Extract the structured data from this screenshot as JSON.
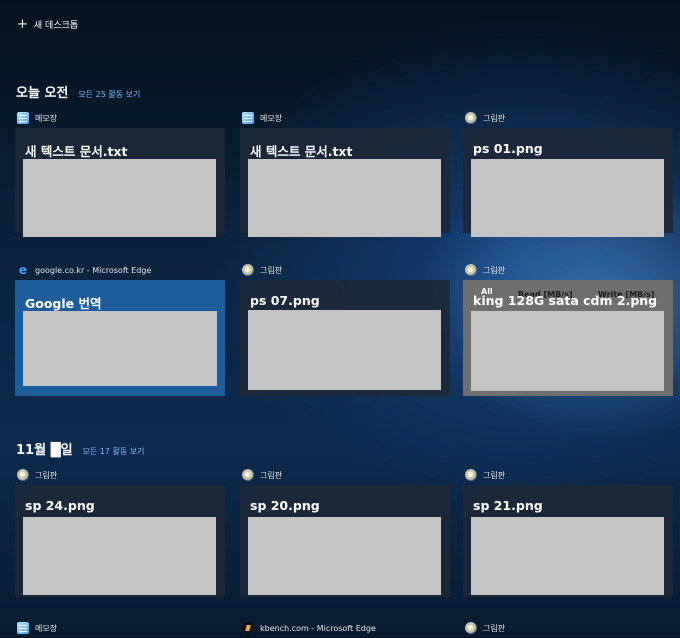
{
  "new_desktop": {
    "label": "새 데스크톱"
  },
  "sections": [
    {
      "title": "오늘 오전",
      "link": "모든 25 활동 보기"
    },
    {
      "title": "11월 █일",
      "link": "모든 17 활동 보기"
    }
  ],
  "cards": [
    {
      "app": "메모장",
      "title": "새 텍스트 문서.txt",
      "icon": "notepad-icon"
    },
    {
      "app": "메모장",
      "title": "새 텍스트 문서.txt",
      "icon": "notepad-icon"
    },
    {
      "app": "그림판",
      "title": "ps 01.png",
      "icon": "paint-icon"
    },
    {
      "app": "google.co.kr - Microsoft Edge",
      "title": "Google 번역",
      "icon": "edge-icon"
    },
    {
      "app": "그림판",
      "title": "ps 07.png",
      "icon": "paint-icon"
    },
    {
      "app": "그림판",
      "title": "king 128G sata cdm 2.png",
      "icon": "paint-icon",
      "overlay": [
        "All",
        "Read [MB/s]",
        "Write [MB/s]"
      ]
    },
    {
      "app": "그림판",
      "title": "sp 24.png",
      "icon": "paint-icon"
    },
    {
      "app": "그림판",
      "title": "sp 20.png",
      "icon": "paint-icon"
    },
    {
      "app": "그림판",
      "title": "sp 21.png",
      "icon": "paint-icon"
    },
    {
      "app": "메모장",
      "icon": "notepad-icon"
    },
    {
      "app": "kbench.com - Microsoft Edge",
      "icon": "kbench-icon"
    },
    {
      "app": "그림판",
      "icon": "paint-icon"
    }
  ]
}
